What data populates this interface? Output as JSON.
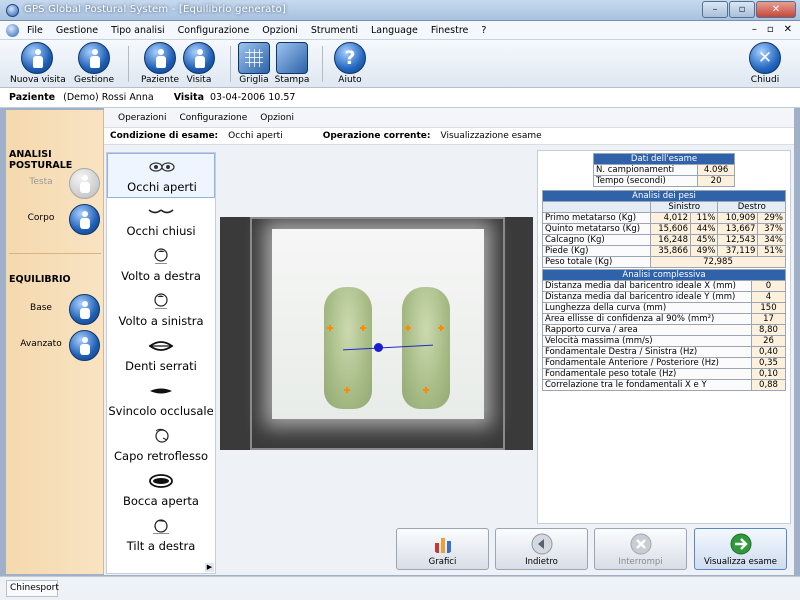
{
  "window": {
    "title": "GPS Global Postural System - [Equilibrio generato]",
    "controls": [
      "–",
      "▫",
      "✕"
    ]
  },
  "menu": {
    "items": [
      "File",
      "Gestione",
      "Tipo analisi",
      "Configurazione",
      "Opzioni",
      "Strumenti",
      "Language",
      "Finestre",
      "?"
    ],
    "mdi_controls": [
      "–",
      "▫",
      "✕"
    ]
  },
  "toolbar": {
    "buttons": [
      {
        "label": "Nuova visita",
        "icon": "person-add-icon"
      },
      {
        "label": "Gestione",
        "icon": "person-icon"
      },
      {
        "label": "Paziente",
        "icon": "patient-icon"
      },
      {
        "label": "Visita",
        "icon": "visit-icon"
      },
      {
        "label": "Griglia",
        "icon": "grid-icon"
      },
      {
        "label": "Stampa",
        "icon": "print-icon"
      },
      {
        "label": "Aiuto",
        "icon": "help-icon"
      },
      {
        "label": "Chiudi",
        "icon": "close-icon"
      }
    ]
  },
  "patient": {
    "label": "Paziente",
    "name": "(Demo) Rossi Anna",
    "visit_label": "Visita",
    "visit_date": "03-04-2006 10.57"
  },
  "left_panel": {
    "section_postural": "ANALISI POSTURALE",
    "testa": "Testa",
    "corpo": "Corpo",
    "section_balance": "EQUILIBRIO",
    "base": "Base",
    "avanzato": "Avanzato"
  },
  "subtabs": [
    "Operazioni",
    "Configurazione",
    "Opzioni"
  ],
  "condition": {
    "label": "Condizione di esame:",
    "value": "Occhi aperti",
    "op_label": "Operazione corrente:",
    "op_value": "Visualizzazione esame"
  },
  "exams": [
    {
      "label": "Occhi aperti",
      "icon": "eyes-open-icon",
      "selected": true
    },
    {
      "label": "Occhi chiusi",
      "icon": "eyes-closed-icon",
      "selected": false
    },
    {
      "label": "Volto a destra",
      "icon": "face-right-icon",
      "selected": false
    },
    {
      "label": "Volto a sinistra",
      "icon": "face-left-icon",
      "selected": false
    },
    {
      "label": "Denti serrati",
      "icon": "mouth-closed-icon",
      "selected": false
    },
    {
      "label": "Svincolo occlusale",
      "icon": "mouth-release-icon",
      "selected": false
    },
    {
      "label": "Capo retroflesso",
      "icon": "head-back-icon",
      "selected": false
    },
    {
      "label": "Bocca aperta",
      "icon": "mouth-open-icon",
      "selected": false
    },
    {
      "label": "Tilt a destra",
      "icon": "head-tilt-icon",
      "selected": false
    }
  ],
  "exam_data": {
    "title": "Dati dell'esame",
    "rows": [
      {
        "label": "N. campionamenti",
        "value": "4.096"
      },
      {
        "label": "Tempo (secondi)",
        "value": "20"
      }
    ]
  },
  "weights": {
    "title": "Analisi dei pesi",
    "col_left": "Sinistro",
    "col_right": "Destro",
    "rows": [
      {
        "label": "Primo metatarso (Kg)",
        "l": "4,012",
        "lp": "11%",
        "r": "10,909",
        "rp": "29%"
      },
      {
        "label": "Quinto metatarso (Kg)",
        "l": "15,606",
        "lp": "44%",
        "r": "13,667",
        "rp": "37%"
      },
      {
        "label": "Calcagno (Kg)",
        "l": "16,248",
        "lp": "45%",
        "r": "12,543",
        "rp": "34%"
      },
      {
        "label": "Piede (Kg)",
        "l": "35,866",
        "lp": "49%",
        "r": "37,119",
        "rp": "51%"
      }
    ],
    "total_label": "Peso totale (Kg)",
    "total_value": "72,985"
  },
  "complex": {
    "title": "Analisi complessiva",
    "rows": [
      {
        "label": "Distanza media dal baricentro ideale X (mm)",
        "value": "0"
      },
      {
        "label": "Distanza media dal baricentro ideale Y (mm)",
        "value": "4"
      },
      {
        "label": "Lunghezza della curva (mm)",
        "value": "150"
      },
      {
        "label": "Area ellisse di confidenza al 90% (mm²)",
        "value": "17"
      },
      {
        "label": "Rapporto curva / area",
        "value": "8,80"
      },
      {
        "label": "Velocità massima (mm/s)",
        "value": "26"
      },
      {
        "label": "Fondamentale Destra / Sinistra (Hz)",
        "value": "0,40"
      },
      {
        "label": "Fondamentale Anteriore / Posteriore (Hz)",
        "value": "0,35"
      },
      {
        "label": "Fondamentale peso totale (Hz)",
        "value": "0,10"
      },
      {
        "label": "Correlazione tra le fondamentali X e Y",
        "value": "0,88"
      }
    ]
  },
  "actions": [
    {
      "label": "Grafici",
      "icon": "chart-icon",
      "enabled": true,
      "primary": false
    },
    {
      "label": "Indietro",
      "icon": "back-arrow-icon",
      "enabled": true,
      "primary": false
    },
    {
      "label": "Interrompi",
      "icon": "stop-icon",
      "enabled": false,
      "primary": false
    },
    {
      "label": "Visualizza esame",
      "icon": "forward-arrow-icon",
      "enabled": true,
      "primary": true
    }
  ],
  "status": {
    "left": "Chinesport"
  },
  "colors": {
    "accent": "#2f62a8",
    "left_panel": "#f5d9ae",
    "value_cell": "#fdf1de",
    "go_green": "#2e9a3a"
  }
}
